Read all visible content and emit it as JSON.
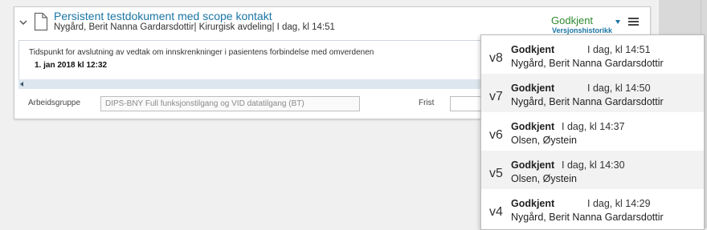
{
  "document": {
    "title": "Persistent testdokument med scope kontakt",
    "meta": "Nygård, Berit Nanna Gardarsdottir| Kirurgisk avdeling| I dag, kl 14:51",
    "status": "Godkjent",
    "version_history_label": "Versjonshistorikk",
    "deadline_label": "Tidspunkt for avslutning av vedtak om innskrenkninger i pasientens forbindelse med omverdenen",
    "deadline_value": "1. jan 2018 kl 12:32",
    "workgroup_label": "Arbeidsgruppe",
    "workgroup_value": "DIPS-BNY Full funksjonstilgang og VID datatilgang (BT)",
    "frist_label": "Frist"
  },
  "versions": [
    {
      "version": "v8",
      "status": "Godkjent",
      "time": "I dag, kl 14:51",
      "person": "Nygård, Berit Nanna Gardarsdottir"
    },
    {
      "version": "v7",
      "status": "Godkjent",
      "time": "I dag, kl 14:50",
      "person": "Nygård, Berit Nanna Gardarsdottir"
    },
    {
      "version": "v6",
      "status": "Godkjent",
      "time": "I dag, kl 14:37",
      "person": "Olsen, Øystein"
    },
    {
      "version": "v5",
      "status": "Godkjent",
      "time": "I dag, kl 14:30",
      "person": "Olsen, Øystein"
    },
    {
      "version": "v4",
      "status": "Godkjent",
      "time": "I dag, kl 14:29",
      "person": "Nygård, Berit Nanna Gardarsdottir"
    }
  ],
  "icons": {
    "collapse": "chevron-down-icon",
    "document": "document-icon",
    "dropdown": "caret-down-icon",
    "menu": "hamburger-menu-icon",
    "scroll_left": "scroll-left-arrow-icon"
  },
  "colors": {
    "title_link": "#1a75a5",
    "status_approved": "#2e8a2e",
    "dropdown_alt_row": "#f2f2f2"
  }
}
